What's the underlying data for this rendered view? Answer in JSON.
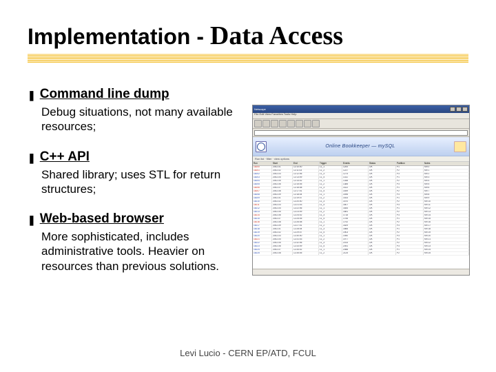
{
  "title": {
    "part1": "Implementation - ",
    "part2": "Data Access"
  },
  "items": [
    {
      "head": "Command line dump",
      "desc": "Debug situations, not many available resources;"
    },
    {
      "head": "C++ API",
      "desc": "Shared library; uses STL for return structures;"
    },
    {
      "head": "Web-based browser",
      "desc": "More sophisticated, includes administrative tools. Heavier on resources than previous solutions."
    }
  ],
  "footer": "Levi Lucio - CERN EP/ATD, FCUL",
  "mock": {
    "header_text": "Online Bookkeeper — mySQL",
    "menu": "File   Edit   View   Favorites   Tools   Help",
    "subhead": "Run list  ·  filter  ·  view options",
    "cols": [
      "Run",
      "Start",
      "End",
      "Trigger",
      "Events",
      "Status",
      "Partition",
      "Notes"
    ]
  }
}
